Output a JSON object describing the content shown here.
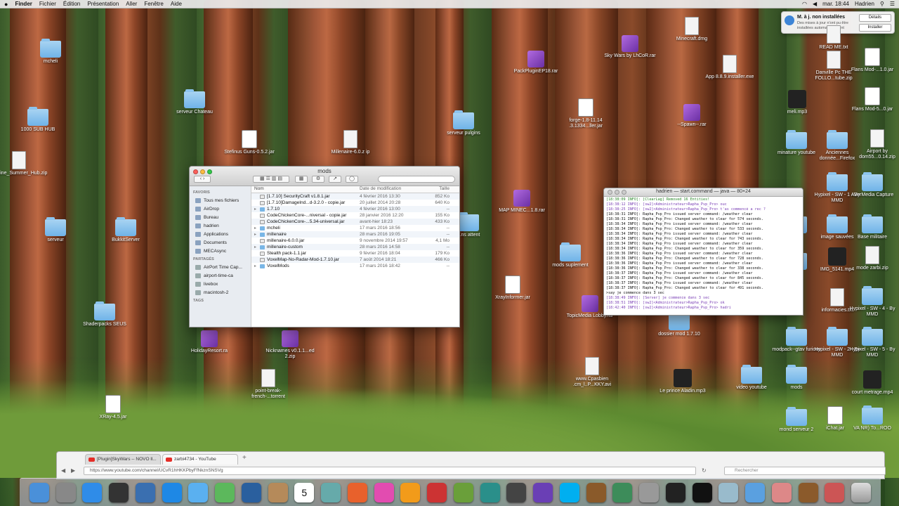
{
  "menubar": {
    "apple": "",
    "app": "Finder",
    "items": [
      "Fichier",
      "Édition",
      "Présentation",
      "Aller",
      "Fenêtre",
      "Aide"
    ],
    "clock": "mar. 18:44",
    "user": "Hadrien"
  },
  "notification": {
    "title": "M. à j. non installées",
    "body": "Des mises à jour n'ont pu être installées automatiquement",
    "details": "Détails",
    "install": "Installer"
  },
  "desktop_icons": [
    {
      "label": "mcheli",
      "kind": "folder"
    },
    {
      "label": "1000 SUB HUB",
      "kind": "folder"
    },
    {
      "label": "serveur Chateau",
      "kind": "folder"
    },
    {
      "label": "Alpine_Summer_Hub.zip",
      "kind": "file"
    },
    {
      "label": "Stefinus Guns-0.5.2.jar",
      "kind": "jar"
    },
    {
      "label": "Millenaire-6.0.z ip",
      "kind": "file"
    },
    {
      "label": "serveur",
      "kind": "folder"
    },
    {
      "label": "BukkitServer",
      "kind": "folder"
    },
    {
      "label": "Shaderpacks SEUS",
      "kind": "folder"
    },
    {
      "label": "HolidayResort.ra",
      "kind": "rar"
    },
    {
      "label": "Nicknames v0.1.1...ed 2.zip",
      "kind": "rar"
    },
    {
      "label": "point-break-french-...torrent",
      "kind": "file"
    },
    {
      "label": "XRay-4.5.jar",
      "kind": "jar"
    },
    {
      "label": "PackPluginEP18.rar",
      "kind": "rar"
    },
    {
      "label": "serveur pulgins",
      "kind": "folder"
    },
    {
      "label": "MAP MINEC...1.8.rar",
      "kind": "rar"
    },
    {
      "label": "...ns attent",
      "kind": "folder"
    },
    {
      "label": "XrayInformer.jar",
      "kind": "jar"
    },
    {
      "label": "mods suplement",
      "kind": "folder"
    },
    {
      "label": "forge-1.8-11.14 .3.1334...ller.jar",
      "kind": "jar"
    },
    {
      "label": "TopicMedia Lobby.rar",
      "kind": "rar"
    },
    {
      "label": "Sky Wars by LhCoR.rar",
      "kind": "rar"
    },
    {
      "label": "--Spawn--.rar",
      "kind": "rar"
    },
    {
      "label": "Minecraft.dmg",
      "kind": "file"
    },
    {
      "label": "App 8.8.9.installer.exe",
      "kind": "file"
    },
    {
      "label": "www.Cpasbien .cm_l..P...KKY.avi",
      "kind": "file"
    },
    {
      "label": "dossier mod 1.7.10",
      "kind": "folder"
    },
    {
      "label": "Le prince Aladin.mp3",
      "kind": "media"
    },
    {
      "label": "video youtube",
      "kind": "folder"
    },
    {
      "label": "mods",
      "kind": "folder"
    },
    {
      "label": "mond serveur 2",
      "kind": "folder"
    },
    {
      "label": "iChat.jar",
      "kind": "jar"
    },
    {
      "label": "meli.mp3",
      "kind": "media"
    },
    {
      "label": "minature youtube",
      "kind": "folder"
    },
    {
      "label": "Danville Pc THE FOLLO...tube.zip",
      "kind": "file"
    },
    {
      "label": "Anciennes donnée...Firefox",
      "kind": "folder"
    },
    {
      "label": "Hypixel - SW - 1 - By MMD",
      "kind": "folder"
    },
    {
      "label": "image sauvées",
      "kind": "folder"
    },
    {
      "label": "IMG_5141.mp4",
      "kind": "media"
    },
    {
      "label": "informacies.txt",
      "kind": "file"
    },
    {
      "label": "modpack--gtav furious",
      "kind": "folder"
    },
    {
      "label": "Hypixel - SW - 2 - By MMD",
      "kind": "folder"
    },
    {
      "label": "Flans Mod-...1.0.jar",
      "kind": "jar"
    },
    {
      "label": "Flans Mod-5...0.jar",
      "kind": "jar"
    },
    {
      "label": "Airport by dom55...0.14.zip",
      "kind": "file"
    },
    {
      "label": "AVerMedia Capture",
      "kind": "folder"
    },
    {
      "label": "Base militaire",
      "kind": "folder"
    },
    {
      "label": "mode zarbi.zip",
      "kind": "file"
    },
    {
      "label": "Hypixel - SW - 4 - By MMD",
      "kind": "folder"
    },
    {
      "label": "Hypixel - SW - 5 - By MMD",
      "kind": "folder"
    },
    {
      "label": "court metrage.mp4",
      "kind": "media"
    },
    {
      "label": "VA NR) To...ROO",
      "kind": "folder"
    },
    {
      "label": "READ ME.txt",
      "kind": "file"
    },
    {
      "label": "...nu",
      "kind": "folder"
    },
    {
      "label": "...bi",
      "kind": "folder"
    }
  ],
  "finder": {
    "title": "mods",
    "search_placeholder": "",
    "favoris_header": "FAVORIS",
    "favoris": [
      "Tous mes fichiers",
      "AirDrop",
      "Bureau",
      "hadrien",
      "Applications",
      "Documents",
      "MECAsync"
    ],
    "partages_header": "PARTAGÉS",
    "partages": [
      "AirPort Time Cap...",
      "airport-time-ca",
      "livebox",
      "macintosh-2"
    ],
    "tags_header": "TAGS",
    "columns": {
      "name": "Nom",
      "date": "Date de modification",
      "size": "Taille"
    },
    "rows": [
      {
        "name": "[1.7.10] SecurityCraft v1.8.1.jar",
        "date": "4 février 2016 13:30",
        "size": "852 Ko",
        "type": "jar",
        "disclosure": ""
      },
      {
        "name": "[1.7.10]DamageInd...d-3.2.0 - copie.jar",
        "date": "20 juillet 2014 20:28",
        "size": "640 Ko",
        "type": "jar",
        "disclosure": ""
      },
      {
        "name": "1.7.10",
        "date": "4 février 2016 13:00",
        "size": "--",
        "type": "folder",
        "disclosure": "▸"
      },
      {
        "name": "CodeChickenCore-...niversal - copie.jar",
        "date": "28 janvier 2016 12:20",
        "size": "155 Ko",
        "type": "jar",
        "disclosure": ""
      },
      {
        "name": "CodeChickenCore-...5.34-universal.jar",
        "date": "avant-hier 18:23",
        "size": "433 Ko",
        "type": "jar",
        "disclosure": ""
      },
      {
        "name": "mcheli",
        "date": "17 mars 2016 18:56",
        "size": "--",
        "type": "folder",
        "disclosure": "▸"
      },
      {
        "name": "millenaire",
        "date": "28 mars 2016 19:05",
        "size": "--",
        "type": "folder",
        "disclosure": "▸"
      },
      {
        "name": "millenaire-6.0.0.jar",
        "date": "9 novembre 2014 19:57",
        "size": "4,1 Mo",
        "type": "jar",
        "disclosure": ""
      },
      {
        "name": "millenaire-custom",
        "date": "28 mars 2016 14:58",
        "size": "--",
        "type": "folder",
        "disclosure": "▸"
      },
      {
        "name": "Stealth pack-1.1.jar",
        "date": "9 février 2016 18:04",
        "size": "179 Ko",
        "type": "jar",
        "disclosure": ""
      },
      {
        "name": "VoxelMap-No-Radar-Mod-1.7.10.jar",
        "date": "7 août 2014 18:21",
        "size": "466 Ko",
        "type": "jar",
        "disclosure": ""
      },
      {
        "name": "VoxelMods",
        "date": "17 mars 2016 18:42",
        "size": "--",
        "type": "folder",
        "disclosure": "▸"
      }
    ]
  },
  "terminal": {
    "title": "hadrien — start.command — java — 80×24",
    "lines": [
      {
        "text": "[18:38:09 INFO]: [ClearLag] Removed 16 Entities!",
        "color": "g"
      },
      {
        "text": "[18:38:12 INFO]: [sw2]<Administrateur>Rapha_Pvp_Pro> ouc",
        "color": "p"
      },
      {
        "text": "[18:38:25 INFO]: [sw2]<Administrateur>Rapha_Pvp_Pro> t'as commencé a rec ?",
        "color": "p"
      },
      {
        "text": "[18:38:31 INFO]: Rapha_Pvp_Pro issued server command: /weather clear",
        "color": ""
      },
      {
        "text": "[18:38:31 INFO]: Rapha_Pvp_Pro: Changed weather to clear for 574 seconds.",
        "color": ""
      },
      {
        "text": "[18:38:34 INFO]: Rapha_Pvp_Pro issued server command: /weather clear",
        "color": ""
      },
      {
        "text": "[18:38:34 INFO]: Rapha_Pvp_Pro: Changed weather to clear for 533 seconds.",
        "color": ""
      },
      {
        "text": "[18:38:34 INFO]: Rapha_Pvp_Pro issued server command: /weather clear",
        "color": ""
      },
      {
        "text": "[18:38:34 INFO]: Rapha_Pvp_Pro: Changed weather to clear for 743 seconds.",
        "color": ""
      },
      {
        "text": "[18:38:34 INFO]: Rapha_Pvp_Pro issued server command: /weather clear",
        "color": ""
      },
      {
        "text": "[18:38:34 INFO]: Rapha_Pvp_Pro: Changed weather to clear for 359 seconds.",
        "color": ""
      },
      {
        "text": "[18:38:36 INFO]: Rapha_Pvp_Pro issued server command: /weather clear",
        "color": ""
      },
      {
        "text": "[18:38:36 INFO]: Rapha_Pvp_Pro: Changed weather to clear for 728 seconds.",
        "color": ""
      },
      {
        "text": "[18:38:36 INFO]: Rapha_Pvp_Pro issued server command: /weather clear",
        "color": ""
      },
      {
        "text": "[18:38:36 INFO]: Rapha_Pvp_Pro: Changed weather to clear for 338 seconds.",
        "color": ""
      },
      {
        "text": "[18:38:37 INFO]: Rapha_Pvp_Pro issued server command: /weather clear",
        "color": ""
      },
      {
        "text": "[18:38:37 INFO]: Rapha_Pvp_Pro: Changed weather to clear for 845 seconds.",
        "color": ""
      },
      {
        "text": "[18:38:37 INFO]: Rapha_Pvp_Pro issued server command: /weather clear",
        "color": ""
      },
      {
        "text": "[18:38:37 INFO]: Rapha_Pvp_Pro: Changed weather to clear for 491 seconds.",
        "color": ""
      },
      {
        "text": ">say je commence dans 3 sec",
        "color": ""
      },
      {
        "text": "[18:38:49 INFO]: [Server] je commence dans 3 sec",
        "color": "p"
      },
      {
        "text": "[18:38:51 INFO]: [sw2]<Administrateur>Rapha_Pvp_Pro> ok",
        "color": "p"
      },
      {
        "text": "[18:42:40 INFO]: [sw2]<Administrateur>Rapha_Pvp_Pro> hadri",
        "color": "p"
      }
    ]
  },
  "browser": {
    "tabs": [
      {
        "label": "[Plugin]SkyWars -- NOVO ll..."
      },
      {
        "label": "zarbi4734 - YouTube"
      }
    ],
    "url": "https://www.youtube.com/channel/UCvR1hHKKPbyFfNkznSNSVg",
    "search_placeholder": "Rechercher"
  },
  "dock": {
    "apps": [
      "Finder",
      "Launchpad",
      "App Store",
      "Dashboard",
      "Preview",
      "Safari",
      "Messages",
      "FaceTime",
      "QuickTime",
      "Contacts",
      "Calendar",
      "Photos",
      "Firefox",
      "iTunes",
      "iBooks",
      "Photo Booth",
      "Minecraft",
      "Palm",
      "Chess",
      "iMovie",
      "Skype",
      "GarageBand",
      "Time Machine",
      "System Preferences",
      "Final Cut",
      "Terminal",
      "Migration",
      "Preview 2",
      "Java",
      "Minecraft 2",
      "Java 2"
    ],
    "calendar_day": "5"
  }
}
